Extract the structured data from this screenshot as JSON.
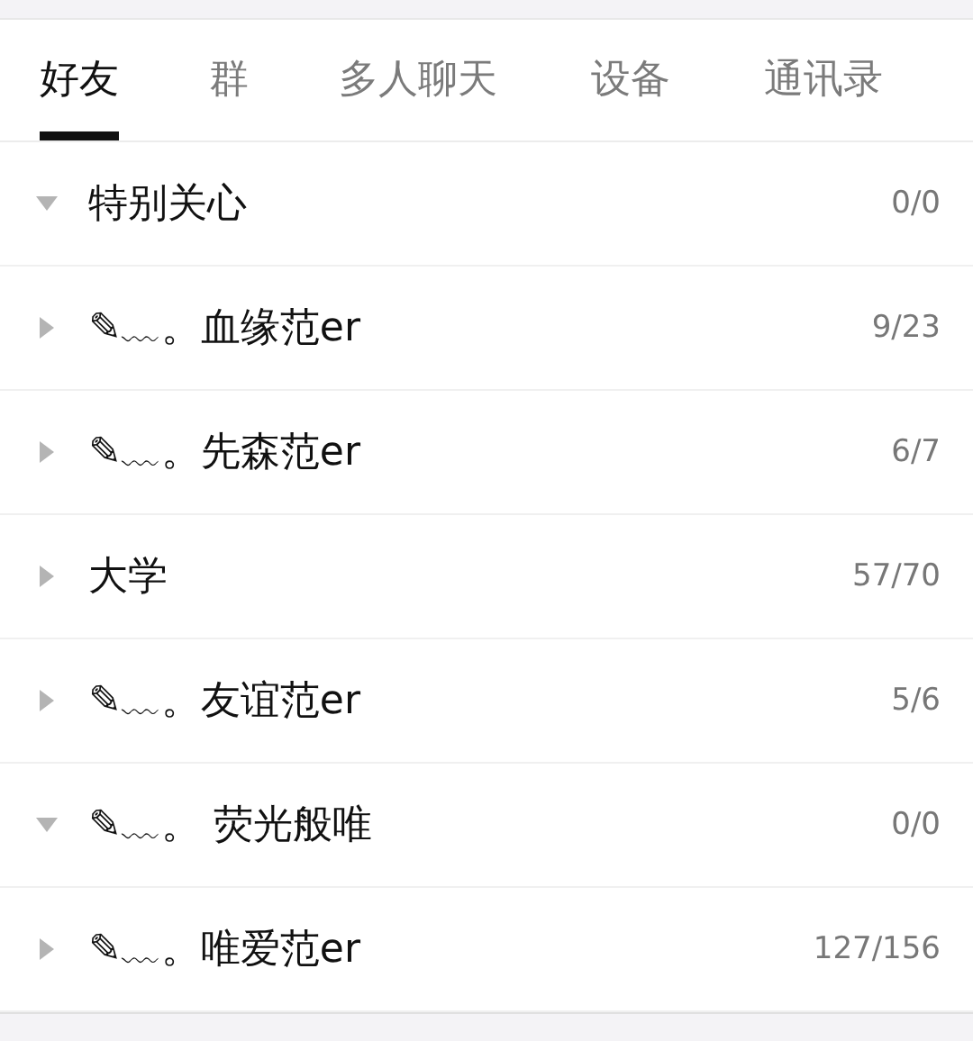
{
  "tabs": [
    {
      "label": "好友",
      "selected": true
    },
    {
      "label": "群",
      "selected": false
    },
    {
      "label": "多人聊天",
      "selected": false
    },
    {
      "label": "设备",
      "selected": false
    },
    {
      "label": "通讯录",
      "selected": false
    }
  ],
  "groups": [
    {
      "name": "特别关心",
      "count": "0/0",
      "expanded": true
    },
    {
      "name": "✎﹏。血缘范er",
      "count": "9/23",
      "expanded": false
    },
    {
      "name": "✎﹏。先森范er",
      "count": "6/7",
      "expanded": false
    },
    {
      "name": "大学",
      "count": "57/70",
      "expanded": false
    },
    {
      "name": "✎﹏。友谊范er",
      "count": "5/6",
      "expanded": false
    },
    {
      "name": "✎﹏。 荧光般唯",
      "count": "0/0",
      "expanded": true
    },
    {
      "name": "✎﹏。唯爱范er",
      "count": "127/156",
      "expanded": false
    }
  ]
}
